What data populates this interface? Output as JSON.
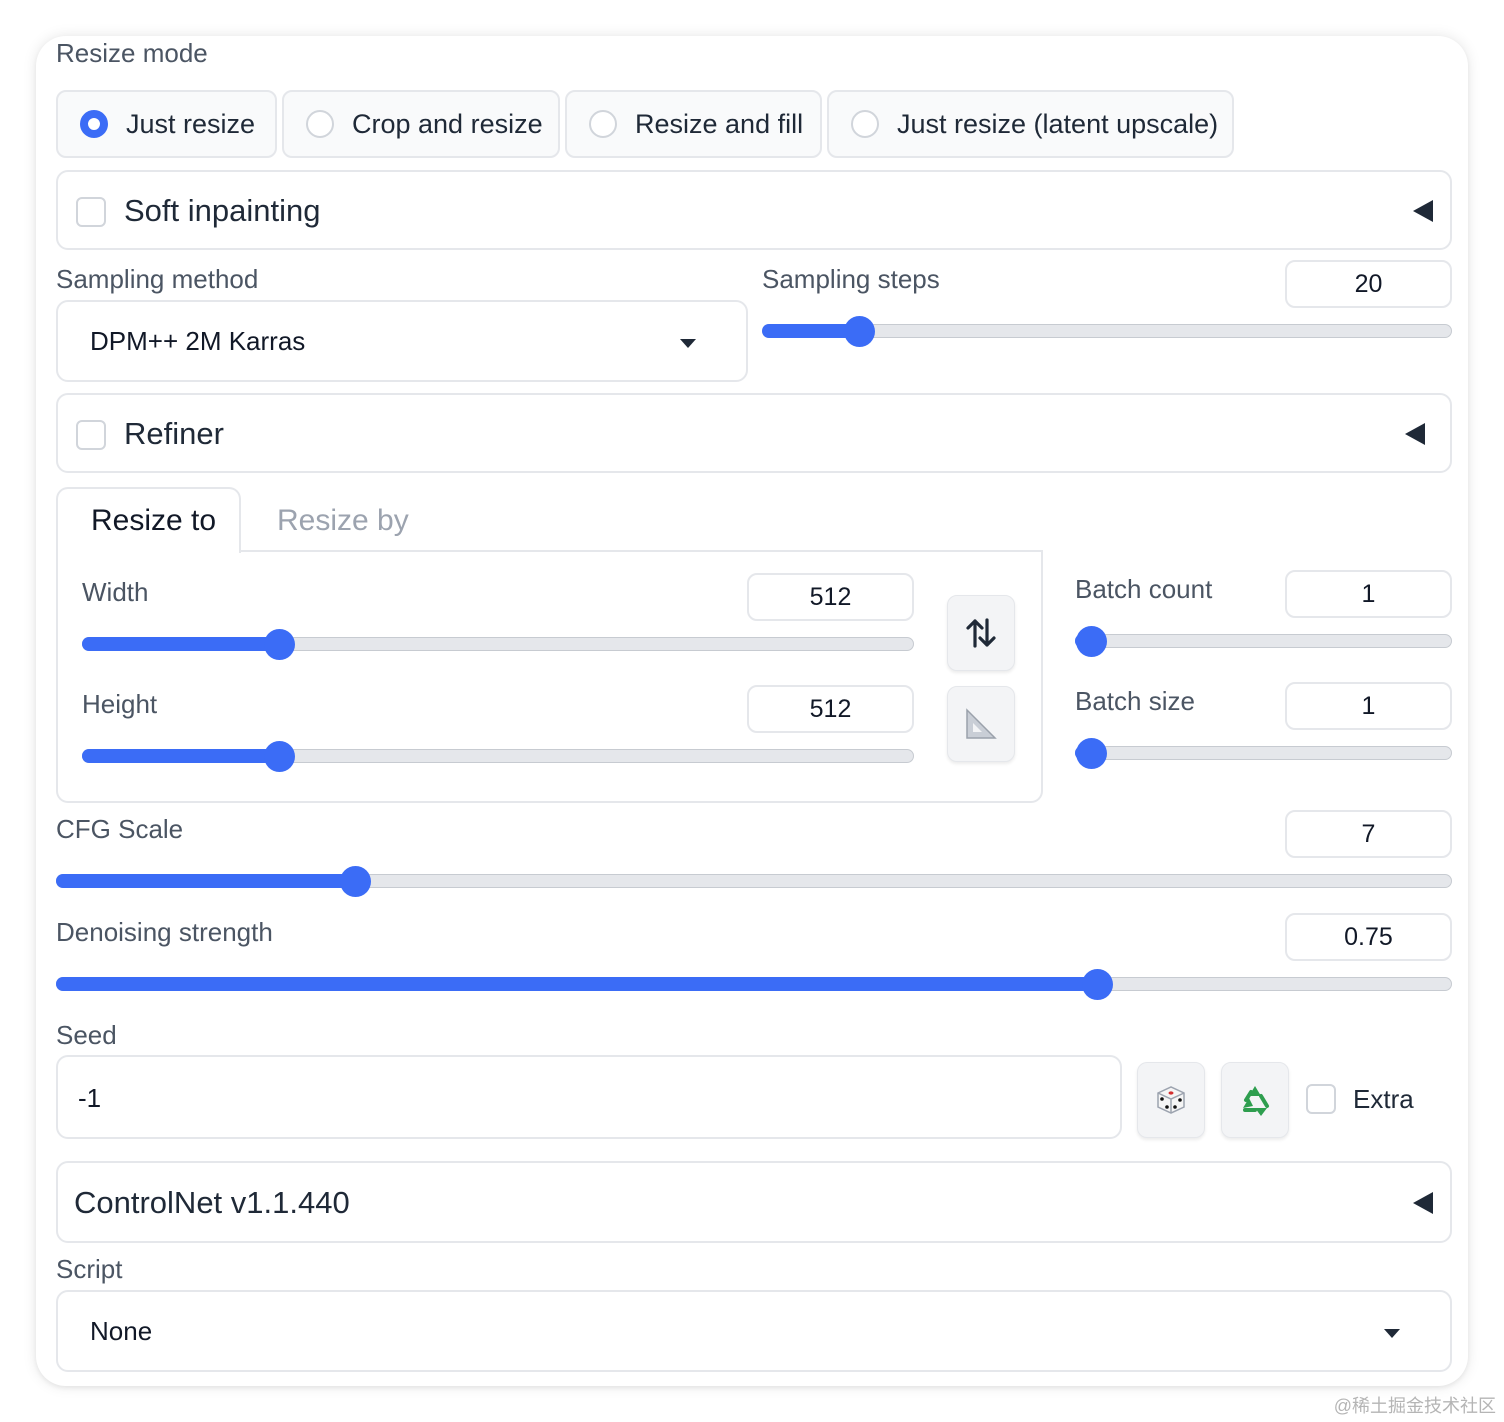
{
  "resize_mode": {
    "label": "Resize mode",
    "options": [
      "Just resize",
      "Crop and resize",
      "Resize and fill",
      "Just resize (latent upscale)"
    ],
    "selected_index": 0
  },
  "soft_inpainting": {
    "label": "Soft inpainting",
    "checked": false,
    "icon": "caret-left-icon"
  },
  "sampling_method": {
    "label": "Sampling method",
    "value": "DPM++ 2M Karras"
  },
  "sampling_steps": {
    "label": "Sampling steps",
    "value": "20",
    "fraction": 0.14
  },
  "refiner": {
    "label": "Refiner",
    "checked": false,
    "icon": "caret-left-icon"
  },
  "tabs": [
    "Resize to",
    "Resize by"
  ],
  "active_tab": 0,
  "width": {
    "label": "Width",
    "value": "512",
    "fraction": 0.237
  },
  "height": {
    "label": "Height",
    "value": "512",
    "fraction": 0.237
  },
  "swap_button_icon": "swap-arrows-icon",
  "ratio_button_icon": "triangle-ruler-icon",
  "batch_count": {
    "label": "Batch count",
    "value": "1",
    "fraction": 0.0
  },
  "batch_size": {
    "label": "Batch size",
    "value": "1",
    "fraction": 0.0
  },
  "cfg_scale": {
    "label": "CFG Scale",
    "value": "7",
    "fraction": 0.214
  },
  "denoising_strength": {
    "label": "Denoising strength",
    "value": "0.75",
    "fraction": 0.746
  },
  "seed": {
    "label": "Seed",
    "value": "-1",
    "random_icon": "dice-icon",
    "reuse_icon": "recycle-icon",
    "extra_label": "Extra",
    "extra_checked": false
  },
  "controlnet": {
    "label": "ControlNet v1.1.440",
    "icon": "caret-left-icon"
  },
  "script": {
    "label": "Script",
    "value": "None"
  },
  "colors": {
    "accent": "#3b6cf6",
    "track": "#e5e7eb",
    "border": "#e5e7eb"
  },
  "watermark": "@稀土掘金技术社区"
}
